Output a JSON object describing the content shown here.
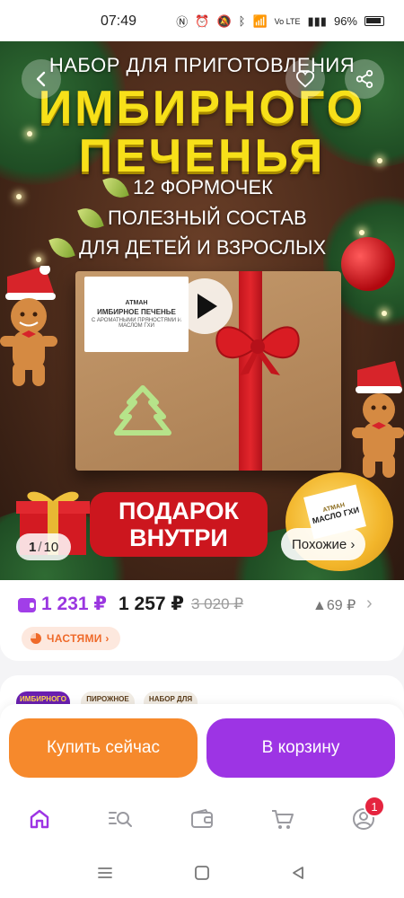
{
  "status_bar": {
    "time": "07:49",
    "battery": "96%",
    "network": "Vo LTE"
  },
  "hero": {
    "line1": "НАБОР ДЛЯ ПРИГОТОВЛЕНИЯ",
    "title1": "ИМБИРНОГО",
    "title2": "ПЕЧЕНЬЯ",
    "bullets": [
      "12 ФОРМОЧЕК",
      "ПОЛЕЗНЫЙ СОСТАВ",
      "ДЛЯ ДЕТЕЙ И ВЗРОСЛЫХ"
    ],
    "box_label": {
      "brand": "АТМАН",
      "title": "ИМБИРНОЕ ПЕЧЕНЬЕ",
      "subtitle": "С АРОМАТНЫМИ ПРЯНОСТЯМИ И МАСЛОМ ГХИ"
    },
    "gift_badge": {
      "line1": "ПОДАРОК",
      "line2": "ВНУТРИ"
    },
    "jar_label": {
      "brand": "АТМАН",
      "title": "МАСЛО ГХИ"
    },
    "counter": {
      "current": "1",
      "total": "10"
    },
    "similar_label": "Похожие ›"
  },
  "price": {
    "wallet_price": "1 231 ₽",
    "main_price": "1 257 ₽",
    "old_price": "3 020 ₽",
    "points": "▲69 ₽",
    "parts_label": "ЧАСТЯМИ ›"
  },
  "thumbs": [
    {
      "label": "ИМБИРНОГО ПЕЧЕНЬЯ"
    },
    {
      "label": "ПИРОЖНОЕ КАРТОШКА"
    },
    {
      "label": "НАБОР ДЛЯ ПРИГОТОВЛЕНИЯ БЕЗДРОЖЖЕВОЙ ХЛЕБ"
    }
  ],
  "actions": {
    "buy_now": "Купить сейчас",
    "add_to_cart": "В корзину"
  },
  "bottom_nav": {
    "profile_badge": "1"
  },
  "colors": {
    "accent_purple": "#9d34e4",
    "accent_orange": "#f6892c",
    "hero_title": "#f7e019",
    "badge_red": "#cc161e"
  }
}
